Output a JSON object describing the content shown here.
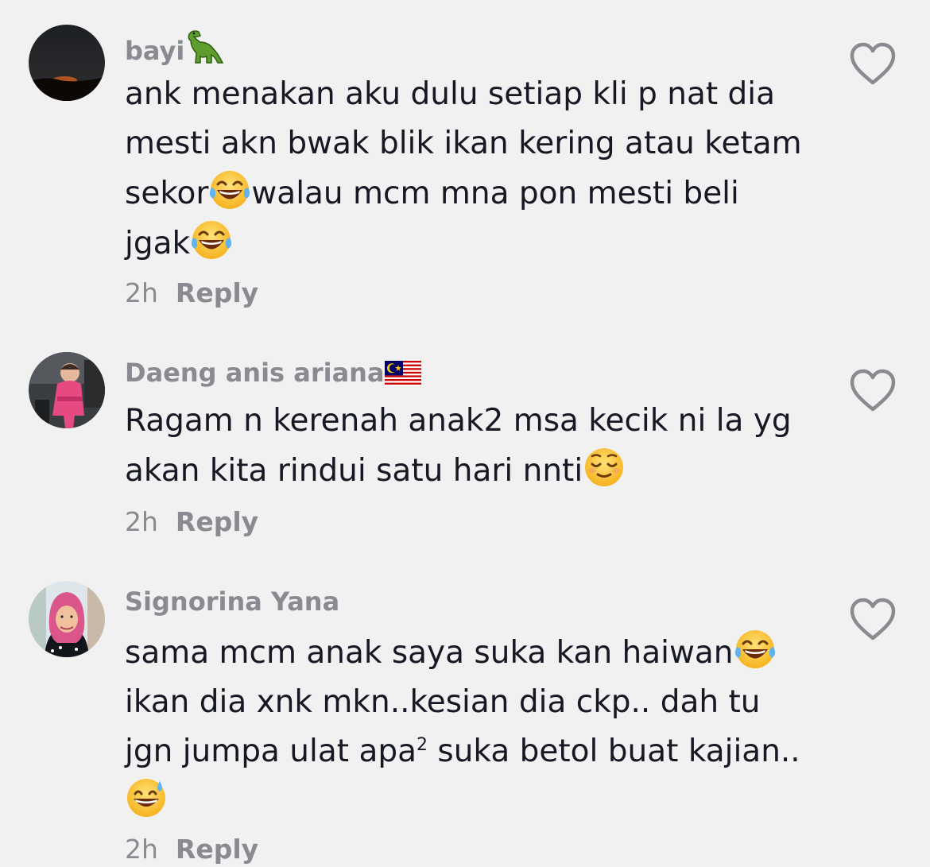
{
  "colors": {
    "background": "#f1f1f2",
    "text_primary": "#161823",
    "text_secondary": "#8a8b91"
  },
  "comments": [
    {
      "username": "bayi",
      "username_icon": "t-rex-emoji",
      "lines": [
        "ank menakan aku dulu setiap kli p nat dia",
        "mesti akn bwak blik ikan kering atau ketam",
        [
          "sekor",
          "walau mcm mna pon mesti beli"
        ],
        "jgak"
      ],
      "emojis": [
        "laughing-tears-emoji",
        "laughing-tears-emoji"
      ],
      "time": "2h",
      "reply_label": "Reply",
      "like_icon": "heart-outline-icon"
    },
    {
      "username": "Daeng anis ariana",
      "username_icon": "malaysia-flag-emoji",
      "lines": [
        "Ragam n kerenah anak2 msa kecik ni la yg",
        "akan kita rindui satu hari nnti"
      ],
      "emojis": [
        "relieved-face-emoji"
      ],
      "time": "2h",
      "reply_label": "Reply",
      "like_icon": "heart-outline-icon"
    },
    {
      "username": "Signorina Yana",
      "lines": [
        "sama mcm anak saya suka kan haiwan",
        "ikan dia xnk mkn..kesian dia ckp.. dah tu",
        [
          "jgn jumpa ulat apa",
          "2",
          " suka betol buat kajian.."
        ]
      ],
      "emojis": [
        "laughing-tears-emoji",
        "grinning-sweat-emoji"
      ],
      "time": "2h",
      "reply_label": "Reply",
      "like_icon": "heart-outline-icon"
    }
  ]
}
